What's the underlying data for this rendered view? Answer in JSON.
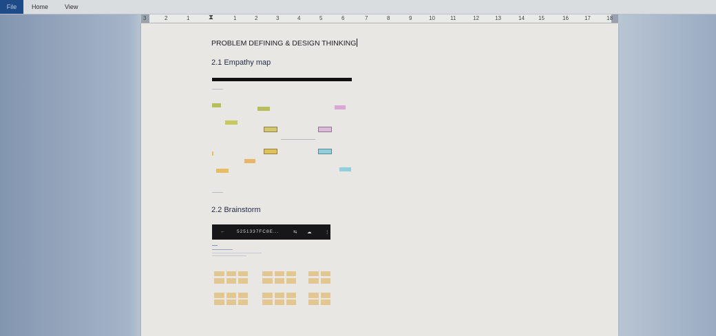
{
  "ribbon": {
    "tabs": [
      {
        "label": "File"
      },
      {
        "label": "Home"
      },
      {
        "label": "View"
      }
    ]
  },
  "ruler": {
    "labels": [
      "3",
      "2",
      "1",
      "1",
      "2",
      "3",
      "4",
      "5",
      "6",
      "7",
      "8",
      "9",
      "10",
      "11",
      "12",
      "13",
      "14",
      "15",
      "16",
      "17",
      "18"
    ]
  },
  "document": {
    "title": "PROBLEM DEFINING & DESIGN THINKING",
    "section_1": "2.1 Empathy map",
    "section_2": "2.2 Brainstorm",
    "phone_bar_text": "5251337FC8E..."
  },
  "colors": {
    "sticky_green": "#b7bf5a",
    "sticky_yellow": "#e0c25a",
    "sticky_pink": "#d9a6d6",
    "sticky_cyan": "#8fd0dc",
    "sticky_orange": "#e6b565"
  }
}
